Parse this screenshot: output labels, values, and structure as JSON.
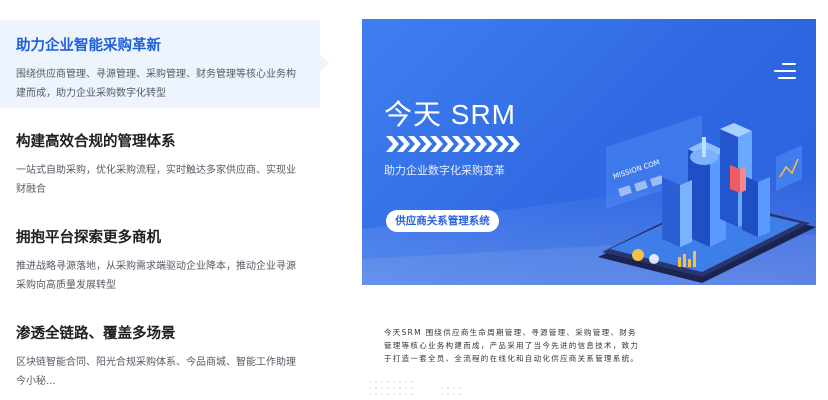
{
  "features": [
    {
      "title": "助力企业智能采购革新",
      "desc": "围绕供应商管理、寻源管理、采购管理、财务管理等核心业务构建而成，助力企业采购数字化转型"
    },
    {
      "title": "构建高效合规的管理体系",
      "desc": "一站式自助采购，优化采购流程，实时触达多家供应商、实现业财融合"
    },
    {
      "title": "拥抱平台探索更多商机",
      "desc": "推进战略寻源落地，从采购需求端驱动企业降本，推动企业寻源采购向高质量发展转型"
    },
    {
      "title": "渗透全链路、覆盖多场景",
      "desc": "区块链智能合同、阳光合规采购体系、今品商城、智能工作助理今小秘..."
    }
  ],
  "panel": {
    "brand": "今天 SRM",
    "slogan": "助力企业数字化采购变革",
    "pill_label": "供应商关系管理系统",
    "illustration_text": "MISSION COM",
    "intro": "今天SRM 围绕供应商生命周期管理、寻源管理、采购管理、财务管理等核心业务构建而成，产品采用了当今先进的信息技术，致力于打造一套全员、全流程的在线化和自动化供应商关系管理系统。"
  },
  "colors": {
    "accent": "#1c5fdc",
    "banner": "#3572e8",
    "active_bg": "#eef4fd"
  }
}
